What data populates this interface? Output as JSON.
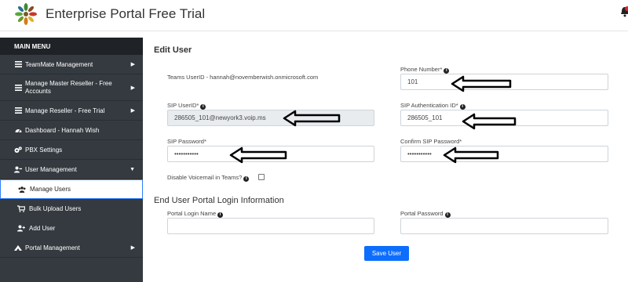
{
  "app": {
    "title": "Enterprise Portal Free Trial"
  },
  "sidebar": {
    "heading": "MAIN MENU",
    "items": [
      {
        "label": "TeamMate Management",
        "icon": "bars-icon"
      },
      {
        "label": "Manage Master Reseller - Free Accounts",
        "icon": "bars-icon"
      },
      {
        "label": "Manage Reseller - Free Trial",
        "icon": "bars-icon"
      },
      {
        "label": "Dashboard - Hannah Wish",
        "icon": "dashboard-icon"
      },
      {
        "label": "PBX Settings",
        "icon": "cogs-icon"
      },
      {
        "label": "User Management",
        "icon": "users-icon"
      },
      {
        "label": "Portal Management",
        "icon": "portal-icon"
      }
    ],
    "sub_items": [
      {
        "label": "Manage Users",
        "icon": "users-icon",
        "active": true
      },
      {
        "label": "Bulk Upload Users",
        "icon": "cart-icon"
      },
      {
        "label": "Add User",
        "icon": "user-plus-icon"
      }
    ]
  },
  "form": {
    "title": "Edit User",
    "teams_userid": "Teams UserID - hannah@novemberwish.onmicrosoft.com",
    "phone_label": "Phone Number*",
    "phone_value": "101",
    "sip_userid_label": "SIP UserID*",
    "sip_userid_value": "286505_101@newyork3.voip.ms",
    "sip_auth_label": "SIP Authentication ID*",
    "sip_auth_value": "286505_101",
    "sip_password_label": "SIP Password*",
    "sip_password_value": "•••••••••••",
    "confirm_password_label": "Confirm SIP Password*",
    "confirm_password_value": "•••••••••••",
    "disable_voicemail_label": "Disable Voicemail in Teams?",
    "portal_section_title": "End User Portal Login Information",
    "portal_login_label": "Portal Login Name",
    "portal_password_label": "Portal Password",
    "save_label": "Save User"
  }
}
